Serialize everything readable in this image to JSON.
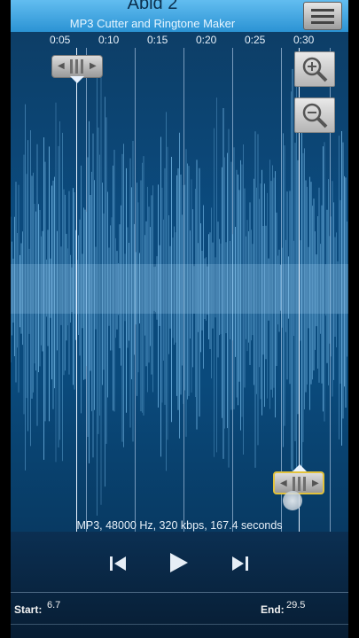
{
  "header": {
    "title": "Abid 2",
    "subtitle": "MP3 Cutter and Ringtone Maker",
    "menu_icon": "menu-icon"
  },
  "timeline": {
    "ticks": [
      "0:05",
      "0:10",
      "0:15",
      "0:20",
      "0:25",
      "0:30"
    ]
  },
  "selection": {
    "start_seconds": 6.7,
    "end_seconds": 29.5
  },
  "zoom": {
    "in_icon": "zoom-in-icon",
    "out_icon": "zoom-out-icon"
  },
  "file_info": "MP3, 48000 Hz, 320 kbps, 167.4 seconds",
  "controls": {
    "previous_icon": "skip-previous-icon",
    "play_icon": "play-icon",
    "next_icon": "skip-next-icon"
  },
  "footer": {
    "start_label": "Start:",
    "start_value": "6.7",
    "end_label": "End:",
    "end_value": "29.5"
  },
  "colors": {
    "wave": "#7cc0ee",
    "background": "#0b4a7d",
    "accent_handle": "#e2c23c"
  }
}
